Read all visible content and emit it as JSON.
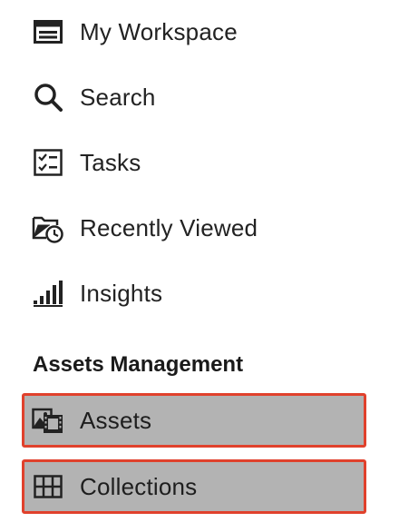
{
  "nav": {
    "items": [
      {
        "label": "My Workspace",
        "icon": "workspace-icon"
      },
      {
        "label": "Search",
        "icon": "search-icon"
      },
      {
        "label": "Tasks",
        "icon": "tasks-checklist-icon"
      },
      {
        "label": "Recently Viewed",
        "icon": "folder-clock-icon"
      },
      {
        "label": "Insights",
        "icon": "bar-chart-icon"
      }
    ],
    "section": {
      "title": "Assets Management",
      "items": [
        {
          "label": "Assets",
          "icon": "assets-media-icon",
          "highlighted": true
        },
        {
          "label": "Collections",
          "icon": "grid-icon",
          "highlighted": true
        }
      ]
    }
  },
  "colors": {
    "highlight_fill": "#b3b3b3",
    "highlight_border": "#e0412c",
    "text": "#222222"
  }
}
